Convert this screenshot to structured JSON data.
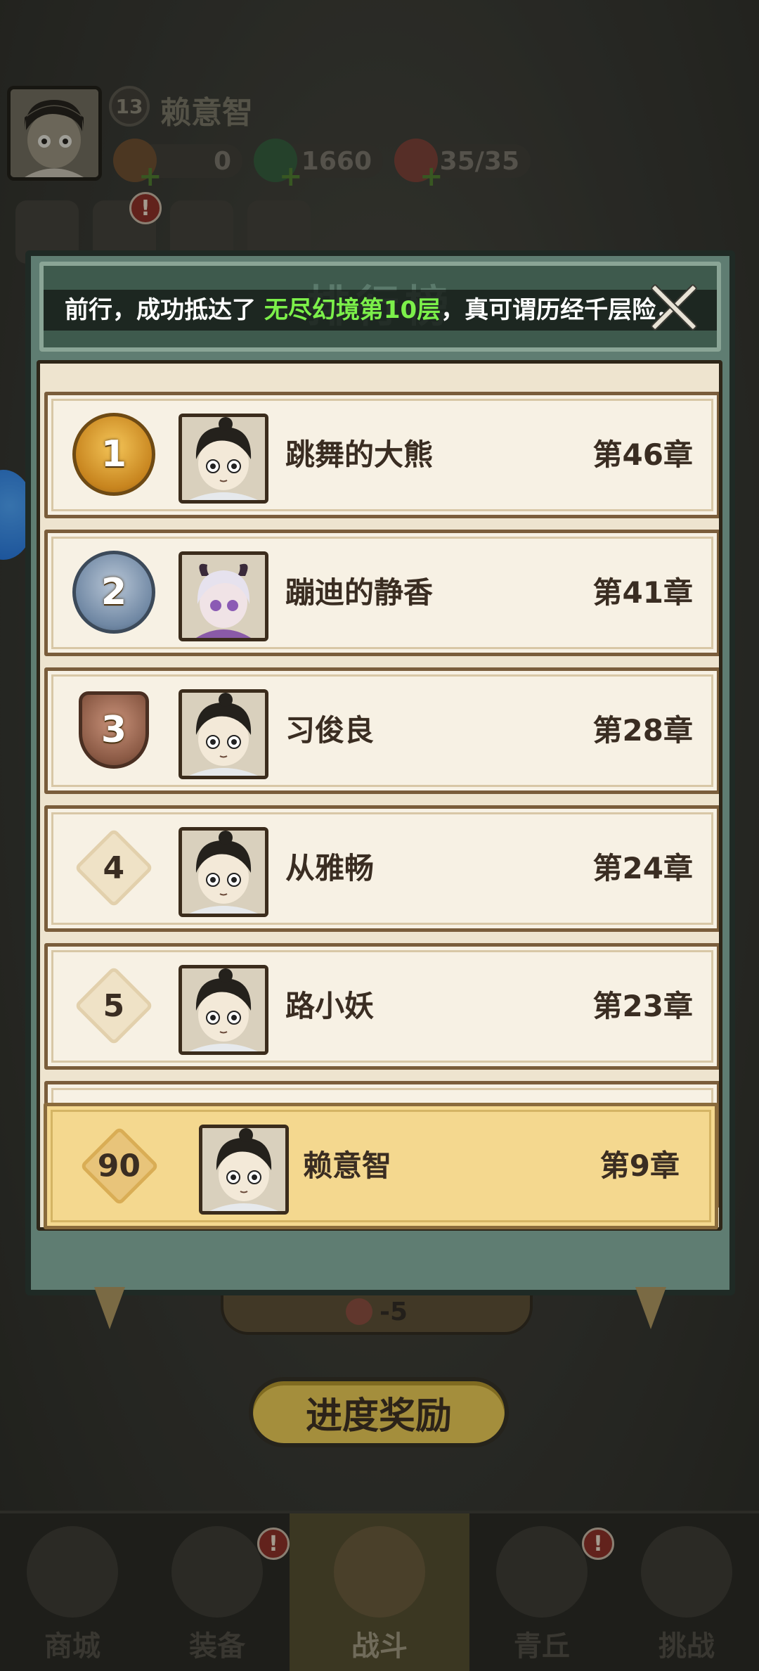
{
  "player": {
    "level": "13",
    "name": "赖意智",
    "resources": [
      {
        "icon": "scroll-icon",
        "value": "0"
      },
      {
        "icon": "jade-dragon-icon",
        "value": "1660"
      },
      {
        "icon": "peach-icon",
        "value": "35/35"
      }
    ]
  },
  "menu": {
    "badge": "!"
  },
  "leaderboard": {
    "title": "排行榜",
    "marquee_prefix": "前行，成功抵达了",
    "marquee_highlight": "无尽幻境第10层",
    "marquee_suffix": "，真可谓历经千层险，",
    "rows": [
      {
        "rank": "1",
        "name": "跳舞的大熊",
        "chapter": "第46章",
        "avatar": "boy-topknot-avatar"
      },
      {
        "rank": "2",
        "name": "蹦迪的静香",
        "chapter": "第41章",
        "avatar": "horned-girl-avatar"
      },
      {
        "rank": "3",
        "name": "习俊良",
        "chapter": "第28章",
        "avatar": "boy-topknot-avatar"
      },
      {
        "rank": "4",
        "name": "从雅畅",
        "chapter": "第24章",
        "avatar": "boy-topknot-avatar"
      },
      {
        "rank": "5",
        "name": "路小妖",
        "chapter": "第23章",
        "avatar": "boy-topknot-avatar"
      }
    ],
    "self": {
      "rank": "90",
      "name": "赖意智",
      "chapter": "第9章"
    }
  },
  "cost": "-5",
  "progress_reward_label": "进度奖励",
  "nav": [
    {
      "label": "商城",
      "badge": ""
    },
    {
      "label": "装备",
      "badge": "!"
    },
    {
      "label": "战斗",
      "badge": "",
      "active": true
    },
    {
      "label": "青丘",
      "badge": "!"
    },
    {
      "label": "挑战",
      "badge": ""
    }
  ]
}
